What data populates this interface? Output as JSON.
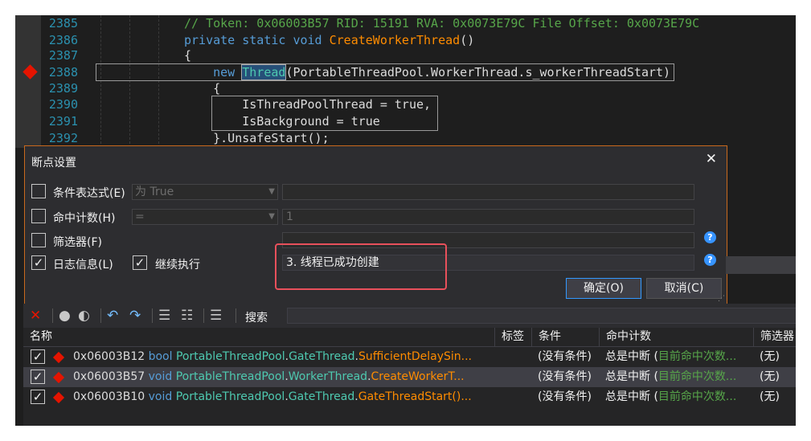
{
  "editor": {
    "lines": [
      {
        "num": "2385",
        "segments": [
          {
            "t": "// Token: 0x06003B57 RID: 15191 RVA: 0x0073E79C File Offset: 0x0073E79C",
            "c": "cm"
          }
        ]
      },
      {
        "num": "2386",
        "segments": [
          {
            "t": "private static void ",
            "c": "kw"
          },
          {
            "t": "CreateWorkerThread",
            "c": "mt"
          },
          {
            "t": "()",
            "c": "tx"
          }
        ]
      },
      {
        "num": "2387",
        "segments": [
          {
            "t": "{",
            "c": "tx"
          }
        ]
      },
      {
        "num": "2388",
        "segments": [
          {
            "t": "    new ",
            "c": "kw"
          },
          {
            "t": "Thread",
            "c": "ty sel"
          },
          {
            "t": "(PortableThreadPool.WorkerThread.s_workerThreadStart)",
            "c": "tx"
          }
        ]
      },
      {
        "num": "2389",
        "segments": [
          {
            "t": "    {",
            "c": "tx"
          }
        ]
      },
      {
        "num": "2390",
        "segments": [
          {
            "t": "        IsThreadPoolThread = true,",
            "c": "tx"
          }
        ]
      },
      {
        "num": "2391",
        "segments": [
          {
            "t": "        IsBackground = true",
            "c": "tx"
          }
        ]
      },
      {
        "num": "2392",
        "segments": [
          {
            "t": "    }.UnsafeStart();",
            "c": "tx"
          }
        ]
      }
    ]
  },
  "dialog": {
    "title": "断点设置",
    "close_icon": "close-icon",
    "condition": {
      "label": "条件表达式(E)",
      "checked": false,
      "combo": "为 True",
      "value": ""
    },
    "hitcount": {
      "label": "命中计数(H)",
      "checked": false,
      "combo": "=",
      "value": "1"
    },
    "filter": {
      "label": "筛选器(F)",
      "checked": false,
      "value": ""
    },
    "log": {
      "label": "日志信息(L)",
      "checked": true,
      "value": "3. 线程已成功创建"
    },
    "continue": {
      "label": "继续执行",
      "checked": true
    },
    "ok_label": "确定(O)",
    "cancel_label": "取消(C)"
  },
  "breakpoints": {
    "toolbar": {
      "search_label": "搜索",
      "search_value": ""
    },
    "columns": [
      "名称",
      "标签",
      "条件",
      "命中计数",
      "筛选器"
    ],
    "rows": [
      {
        "addr": "0x06003B12",
        "ret": "bool",
        "cls": "PortableThreadPool",
        "inner": "GateThread",
        "method": "SufficientDelaySin...",
        "cond": "(没有条件)",
        "hit_a": "总是中断 (",
        "hit_b": "目前命中次数...",
        "filter": "(无)",
        "selected": false
      },
      {
        "addr": "0x06003B57",
        "ret": "void",
        "cls": "PortableThreadPool",
        "inner": "WorkerThread",
        "method": "CreateWorkerT...",
        "cond": "(没有条件)",
        "hit_a": "总是中断 (",
        "hit_b": "目前命中次数...",
        "filter": "(无)",
        "selected": true
      },
      {
        "addr": "0x06003B10",
        "ret": "void",
        "cls": "PortableThreadPool",
        "inner": "GateThread",
        "method": "GateThreadStart()...",
        "cond": "(没有条件)",
        "hit_a": "总是中断 (",
        "hit_b": "目前命中次数...",
        "filter": "(无)",
        "selected": false
      }
    ]
  },
  "colors": {
    "accent": "#c9691d",
    "breakpoint": "#e51400",
    "highlight_box": "#e8505b"
  }
}
